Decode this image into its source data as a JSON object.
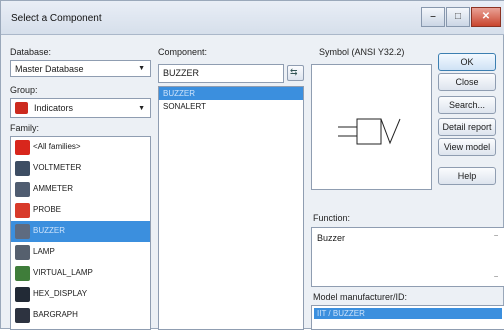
{
  "window": {
    "title": "Select a Component"
  },
  "database": {
    "label": "Database:",
    "value": "Master Database"
  },
  "group": {
    "label": "Group:",
    "value": "Indicators"
  },
  "family": {
    "label": "Family:",
    "items": [
      {
        "label": "<All families>",
        "icon": "all-families-icon",
        "color": "#d8261c"
      },
      {
        "label": "VOLTMETER",
        "icon": "voltmeter-icon",
        "color": "#3d4d63"
      },
      {
        "label": "AMMETER",
        "icon": "ammeter-icon",
        "color": "#4f5c70"
      },
      {
        "label": "PROBE",
        "icon": "probe-icon",
        "color": "#d83a2a"
      },
      {
        "label": "BUZZER",
        "icon": "buzzer-icon",
        "color": "#5e6b80",
        "selected": true
      },
      {
        "label": "LAMP",
        "icon": "lamp-icon",
        "color": "#56606e"
      },
      {
        "label": "VIRTUAL_LAMP",
        "icon": "virtual-lamp-icon",
        "color": "#3f7d3a"
      },
      {
        "label": "HEX_DISPLAY",
        "icon": "hex-display-icon",
        "color": "#222a36"
      },
      {
        "label": "BARGRAPH",
        "icon": "bargraph-icon",
        "color": "#2d3340"
      }
    ]
  },
  "component": {
    "label": "Component:",
    "search_value": "BUZZER",
    "items": [
      {
        "label": "BUZZER",
        "selected": true
      },
      {
        "label": "SONALERT",
        "selected": false
      }
    ]
  },
  "symbol": {
    "label": "Symbol (ANSI Y32.2)"
  },
  "function": {
    "label": "Function:",
    "value": "Buzzer"
  },
  "model": {
    "label": "Model manufacturer/ID:",
    "value": "IIT / BUZZER"
  },
  "buttons": {
    "ok": "OK",
    "close": "Close",
    "search": "Search...",
    "detail_report": "Detail report",
    "view_model": "View model",
    "help": "Help"
  },
  "colors": {
    "selection": "#3b8fde",
    "accent": "#2f6fb3"
  }
}
